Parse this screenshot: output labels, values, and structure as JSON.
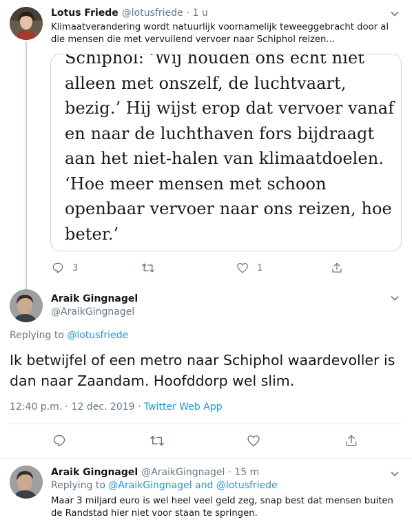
{
  "tweet1": {
    "name": "Lotus Friede",
    "handle": "@lotusfriede",
    "time": "· 1 u",
    "text": "Klimaatverandering wordt natuurlijk voornamelijk teweeggebracht door al die mensen die met vervuilend vervoer naar Schiphol reizen...",
    "quote_lines": [
      "Schiphol: ‘Wij houden ons echt niet",
      "alleen met onszelf, de luchtvaart,",
      "bezig.’ Hij wijst erop dat vervoer vanaf",
      "en naar de luchthaven fors bijdraagt",
      "aan het niet-halen van klimaatdoelen.",
      "‘Hoe meer mensen met schoon",
      "openbaar vervoer naar ons reizen, hoe",
      "beter.’"
    ],
    "reply_count": "3",
    "like_count": "1"
  },
  "tweet2": {
    "name": "Araik Gingnagel",
    "handle": "@AraikGingnagel",
    "replying_prefix": "Replying to ",
    "replying_to": "@lotusfriede",
    "text": "Ik betwijfel of een metro naar Schiphol waardevoller is dan naar Zaandam. Hoofddorp wel slim.",
    "timestamp": "12:40 p.m. · 12 dec. 2019 · ",
    "source": "Twitter Web App"
  },
  "tweet3": {
    "name": "Araik Gingnagel",
    "handle": "@AraikGingnagel",
    "time": "· 15 m",
    "replying_prefix": "Replying to ",
    "replying_to": "@AraikGingnagel and @lotusfriede",
    "text": "Maar 3 miljard euro is wel heel veel geld zeg, snap best dat mensen buiten de Randstad hier niet voor staan te springen."
  },
  "colors": {
    "accent": "#1b95e0",
    "muted": "#657786",
    "divider": "#e6ecf0"
  },
  "icons": [
    "reply-icon",
    "retweet-icon",
    "like-icon",
    "share-icon",
    "chevron-down-icon"
  ]
}
